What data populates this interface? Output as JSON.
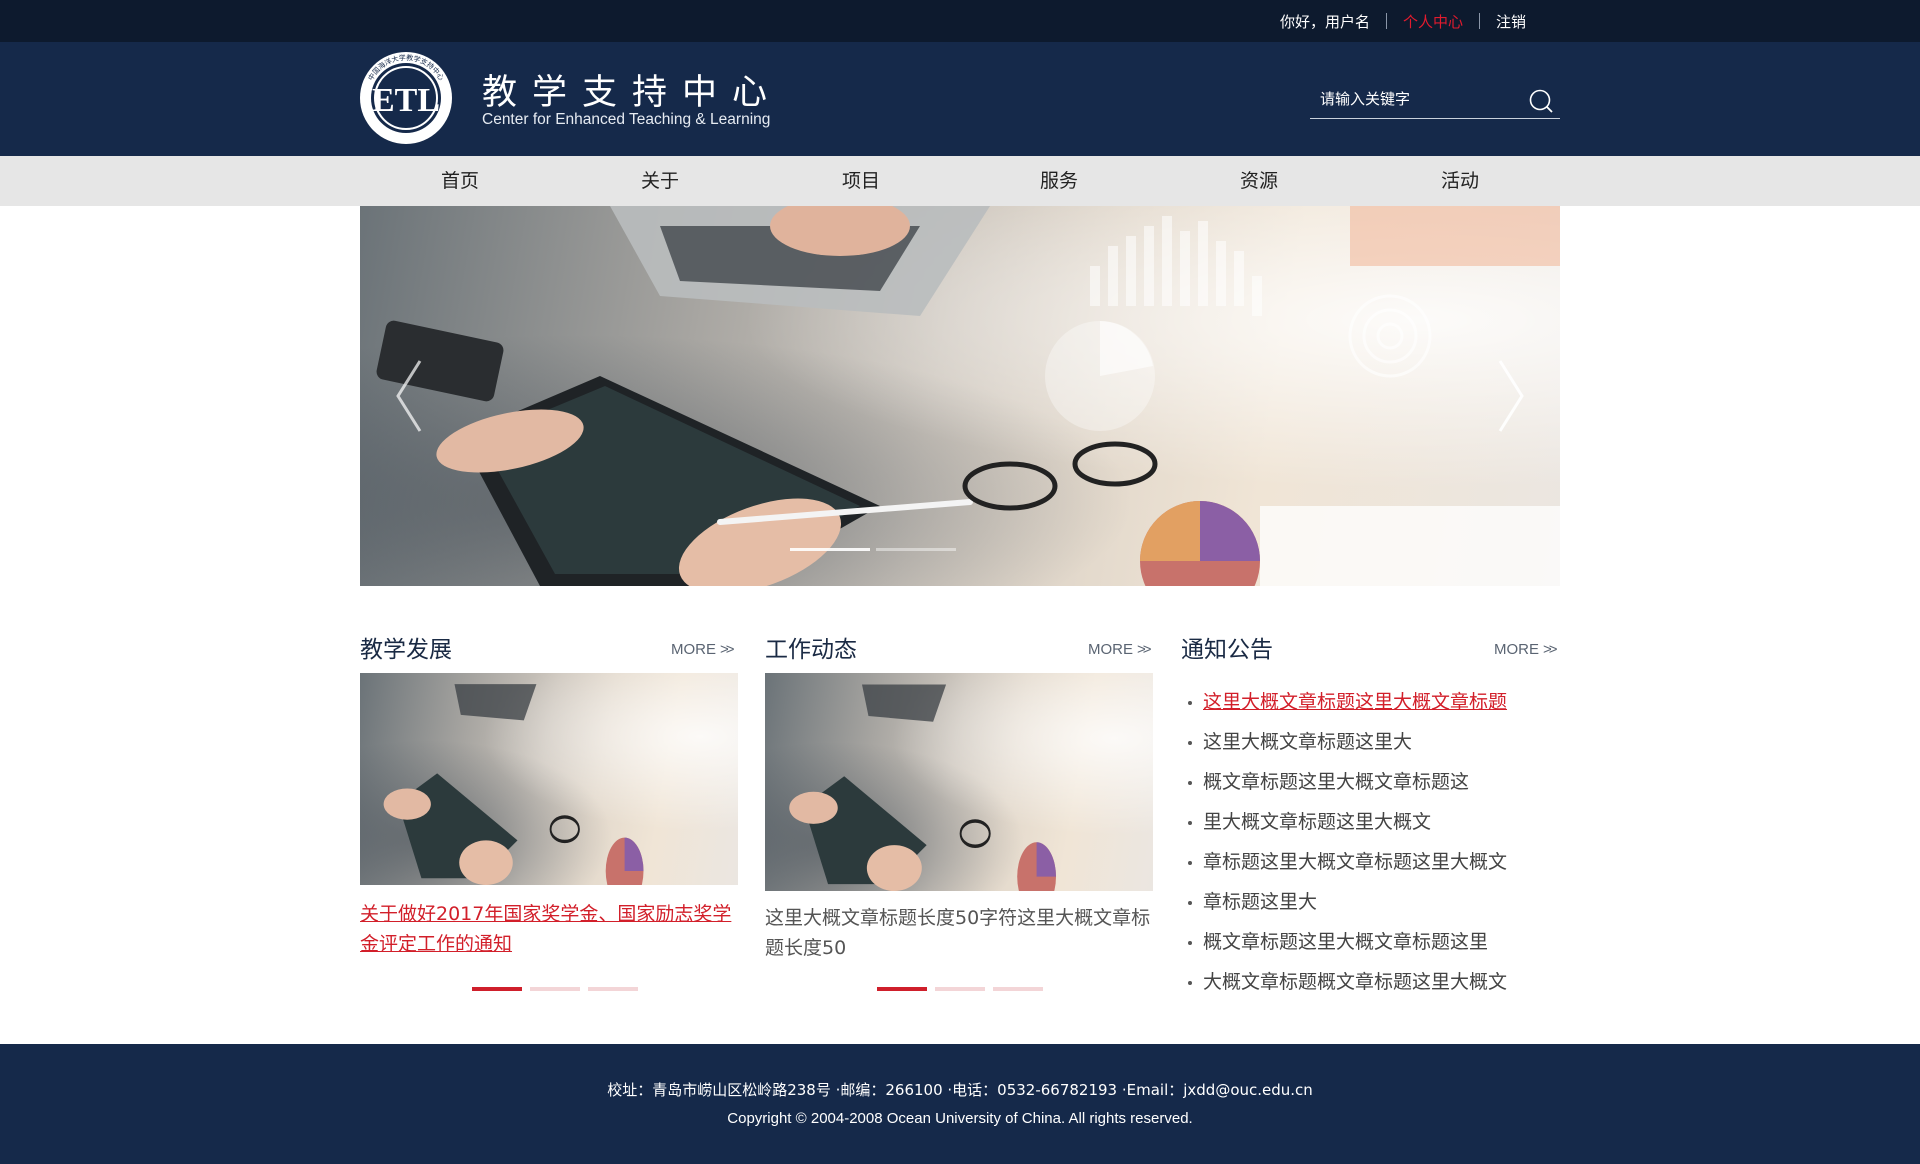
{
  "topbar": {
    "greeting": "你好，用户名",
    "user_center": "个人中心",
    "logout": "注销"
  },
  "header": {
    "logo_text": "中国海洋大学教学支持中心",
    "logo_letters": "ETL",
    "title_cn": "教学支持中心",
    "title_en": "Center for Enhanced Teaching & Learning"
  },
  "search": {
    "placeholder": "请输入关键字",
    "icon": "search-icon"
  },
  "nav": {
    "items": [
      "首页",
      "关于",
      "项目",
      "服务",
      "资源",
      "活动"
    ]
  },
  "banner": {
    "slide_count": 2,
    "active_slide": 1,
    "prev_icon": "chevron-left-icon",
    "next_icon": "chevron-right-icon"
  },
  "sections": {
    "teaching": {
      "title": "教学发展",
      "more": "MORE",
      "caption": "关于做好2017年国家奖学金、国家励志奖学金评定工作的通知",
      "slide_count": 3,
      "active_slide": 1
    },
    "work": {
      "title": "工作动态",
      "more": "MORE",
      "caption": "这里大概文章标题长度50字符这里大概文章标题长度50",
      "slide_count": 3,
      "active_slide": 1
    },
    "notice": {
      "title": "通知公告",
      "more": "MORE",
      "items": [
        "这里大概文章标题这里大概文章标题",
        "这里大概文章标题这里大",
        "概文章标题这里大概文章标题这",
        "里大概文章标题这里大概文",
        "章标题这里大概文章标题这里大概文",
        "章标题这里大",
        "概文章标题这里大概文章标题这里",
        "大概文章标题概文章标题这里大概文"
      ],
      "active_index": 0
    }
  },
  "footer": {
    "address": "校址：青岛市崂山区松岭路238号 ·邮编：266100 ·电话：0532-66782193 ·Email：jxdd@ouc.edu.cn",
    "copyright": "Copyright © 2004-2008 Ocean University of China. All rights reserved."
  },
  "colors": {
    "topbar": "#0d1a2e",
    "header": "#15294a",
    "nav": "#e6e6e6",
    "accent_red": "#d21f2a",
    "footer": "#15294a"
  }
}
